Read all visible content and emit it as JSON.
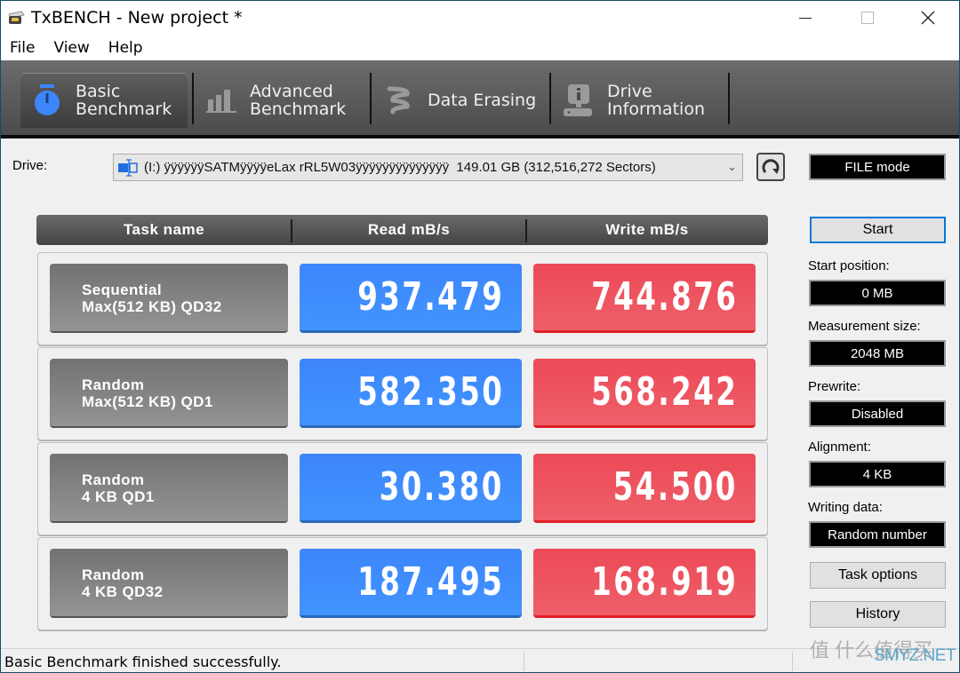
{
  "window": {
    "title": "TxBENCH - New project *"
  },
  "menu": [
    "File",
    "View",
    "Help"
  ],
  "tabs": [
    {
      "line1": "Basic",
      "line2": "Benchmark",
      "icon": "stopwatch-icon",
      "active": true
    },
    {
      "line1": "Advanced",
      "line2": "Benchmark",
      "icon": "bar-chart-icon",
      "active": false
    },
    {
      "line1": "Data Erasing",
      "line2": "",
      "icon": "eraser-spring-icon",
      "active": false
    },
    {
      "line1": "Drive",
      "line2": "Information",
      "icon": "drive-info-icon",
      "active": false
    }
  ],
  "drive": {
    "label": "Drive:",
    "value": "(I:) ÿÿÿÿÿÿSATMÿÿÿÿeLax rRL5W03ÿÿÿÿÿÿÿÿÿÿÿÿÿÿ  149.01 GB (312,516,272 Sectors)"
  },
  "table": {
    "headers": [
      "Task name",
      "Read mB/s",
      "Write mB/s"
    ],
    "rows": [
      {
        "task1": "Sequential",
        "task2": "Max(512 KB) QD32",
        "read": "937.479",
        "write": "744.876"
      },
      {
        "task1": "Random",
        "task2": "Max(512 KB) QD1",
        "read": "582.350",
        "write": "568.242"
      },
      {
        "task1": "Random",
        "task2": "4 KB QD1",
        "read": "30.380",
        "write": "54.500"
      },
      {
        "task1": "Random",
        "task2": "4 KB QD32",
        "read": "187.495",
        "write": "168.919"
      }
    ]
  },
  "side": {
    "mode": "FILE mode",
    "start_label": "Start",
    "start_position_label": "Start position:",
    "start_position": "0 MB",
    "measurement_size_label": "Measurement size:",
    "measurement_size": "2048 MB",
    "prewrite_label": "Prewrite:",
    "prewrite": "Disabled",
    "alignment_label": "Alignment:",
    "alignment": "4 KB",
    "writing_data_label": "Writing data:",
    "writing_data": "Random number",
    "task_options_label": "Task options",
    "history_label": "History"
  },
  "status": {
    "text": "Basic Benchmark finished successfully."
  },
  "watermark": {
    "line1": "值 什么值得买",
    "line2": "SMYZ.NET"
  },
  "colors": {
    "read": "#3d86fb",
    "write": "#ec4a57",
    "accent": "#0078d7"
  }
}
